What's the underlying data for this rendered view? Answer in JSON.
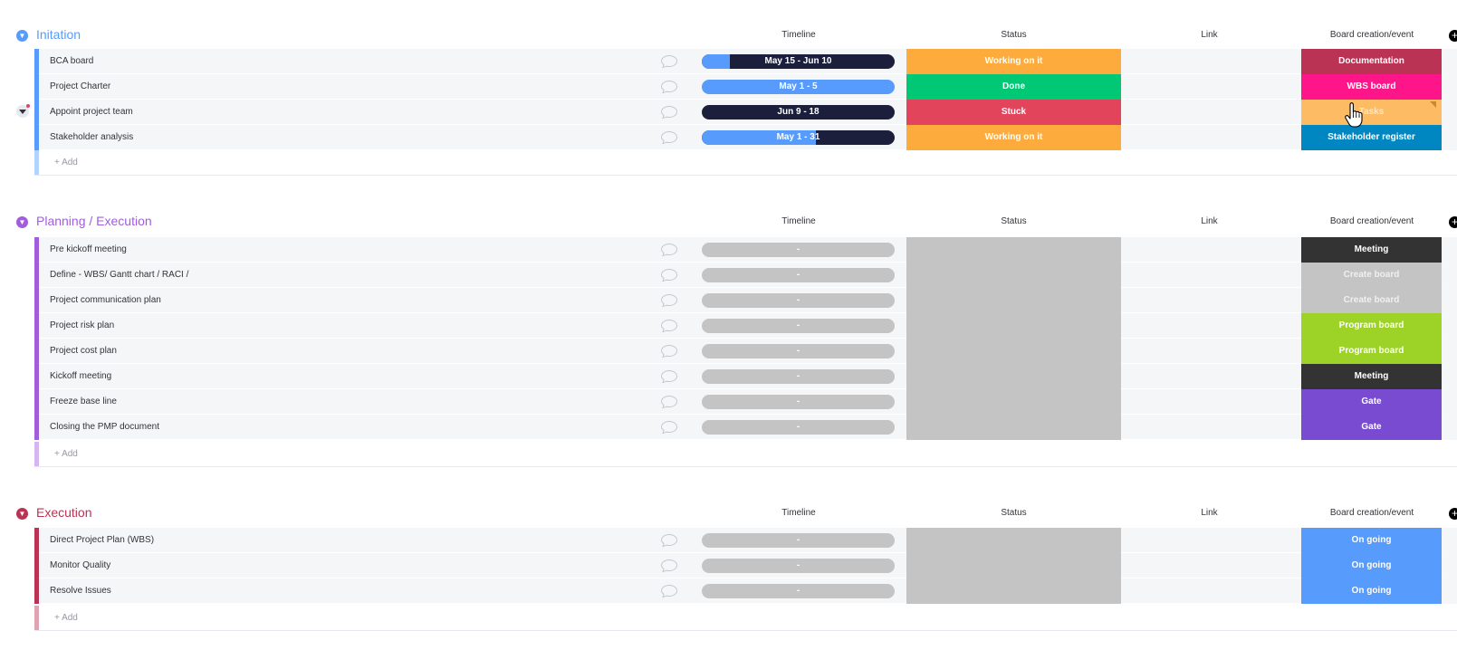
{
  "columns": {
    "timeline": "Timeline",
    "status": "Status",
    "link": "Link",
    "board": "Board creation/event"
  },
  "add_label": "+ Add",
  "groups": [
    {
      "title": "Initation",
      "color": "#579bfc",
      "rows": [
        {
          "name": "BCA board",
          "timeline": "May 15 - Jun 10",
          "status": "Working on it",
          "board": "Documentation"
        },
        {
          "name": "Project Charter",
          "timeline": "May 1 - 5",
          "status": "Done",
          "board": "WBS board"
        },
        {
          "name": "Appoint project team",
          "timeline": "Jun 9 - 18",
          "status": "Stuck",
          "board": "Tasks"
        },
        {
          "name": "Stakeholder analysis",
          "timeline": "May 1 - 31",
          "status": "Working on it",
          "board": "Stakeholder register"
        }
      ]
    },
    {
      "title": "Planning / Execution",
      "color": "#a25ddc",
      "rows": [
        {
          "name": "Pre kickoff meeting",
          "timeline": "-",
          "status": "",
          "board": "Meeting"
        },
        {
          "name": "Define - WBS/ Gantt chart / RACI /",
          "timeline": "-",
          "status": "",
          "board": "Create board"
        },
        {
          "name": "Project communication plan",
          "timeline": "-",
          "status": "",
          "board": "Create board"
        },
        {
          "name": "Project risk plan",
          "timeline": "-",
          "status": "",
          "board": "Program board"
        },
        {
          "name": "Project cost plan",
          "timeline": "-",
          "status": "",
          "board": "Program board"
        },
        {
          "name": "Kickoff meeting",
          "timeline": "-",
          "status": "",
          "board": "Meeting"
        },
        {
          "name": "Freeze base line",
          "timeline": "-",
          "status": "",
          "board": "Gate"
        },
        {
          "name": "Closing the PMP document",
          "timeline": "-",
          "status": "",
          "board": "Gate"
        }
      ]
    },
    {
      "title": "Execution",
      "color": "#bb3354",
      "rows": [
        {
          "name": "Direct Project Plan (WBS)",
          "timeline": "-",
          "status": "",
          "board": "On going"
        },
        {
          "name": "Monitor Quality",
          "timeline": "-",
          "status": "",
          "board": "On going"
        },
        {
          "name": "Resolve Issues",
          "timeline": "-",
          "status": "",
          "board": "On going"
        }
      ]
    }
  ],
  "colors": {
    "working_on_it": "#fdab3d",
    "done": "#00c875",
    "stuck": "#e2445c",
    "empty": "#c4c4c4",
    "timeline_dark": "#1c1f3b",
    "timeline_blue": "#579bfc",
    "documentation": "#bb3354",
    "wbs_board": "#ff158a",
    "tasks_hover": "#fdbc64",
    "stakeholder_register": "#0086c0",
    "meeting": "#333333",
    "create_board": "#c4c4c4",
    "program_board": "#9cd326",
    "gate": "#784bd1",
    "on_going": "#579bfc"
  }
}
